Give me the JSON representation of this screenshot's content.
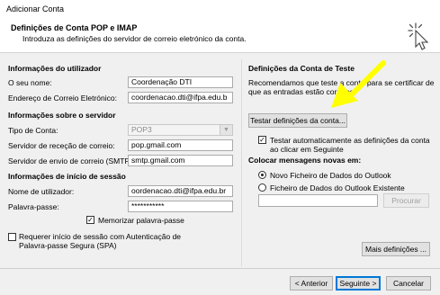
{
  "window": {
    "title": "Adicionar Conta"
  },
  "header": {
    "title": "Definições de Conta POP e IMAP",
    "subtitle": "Introduza as definições do servidor de correio eletrónico da conta."
  },
  "user_info": {
    "section": "Informações do utilizador",
    "name_label": "O seu nome:",
    "name_value": "Coordenação DTI",
    "email_label": "Endereço de Correio Eletrónico:",
    "email_value": "coordenacao.dti@ifpa.edu.b"
  },
  "server_info": {
    "section": "Informações sobre o servidor",
    "account_type_label": "Tipo de Conta:",
    "account_type_value": "POP3",
    "incoming_label": "Servidor de receção de correio:",
    "incoming_value": "pop.gmail.com",
    "outgoing_label": "Servidor de envio de correio (SMTP):",
    "outgoing_value": "smtp.gmail.com"
  },
  "login_info": {
    "section": "Informações de início de sessão",
    "username_label": "Nome de utilizador:",
    "username_value": "oordenacao.dti@ifpa.edu.br",
    "password_label": "Palavra-passe:",
    "password_value": "***********",
    "remember_label": "Memorizar palavra-passe",
    "remember_checked": true,
    "spa_label_line1": "Requerer início de sessão com Autenticação de",
    "spa_label_line2": "Palavra-passe Segura (SPA)",
    "spa_checked": false
  },
  "test_settings": {
    "section": "Definições da Conta de Teste",
    "description_line1": "Recomendamos que teste a conta para se certificar de",
    "description_line2": "que as entradas estão corretas.",
    "test_button": "Testar definições da conta...",
    "auto_test_line1": "Testar automaticamente as definições da conta",
    "auto_test_line2": "ao clicar em Seguinte",
    "auto_test_checked": true
  },
  "delivery": {
    "section": "Colocar mensagens novas em:",
    "option_new": "Novo Ficheiro de Dados do Outlook",
    "option_existing": "Ficheiro de Dados do Outlook Existente",
    "selected": "option_new",
    "browse_button": "Procurar",
    "path_value": ""
  },
  "more_settings_button": "Mais definições ...",
  "footer": {
    "back_button": "< Anterior",
    "next_button": "Seguinte >",
    "cancel_button": "Cancelar"
  },
  "colors": {
    "annotation_arrow": "#ffff00",
    "primary_border": "#0078d7"
  },
  "icons": {
    "header_icon": "cursor-click-icon"
  }
}
